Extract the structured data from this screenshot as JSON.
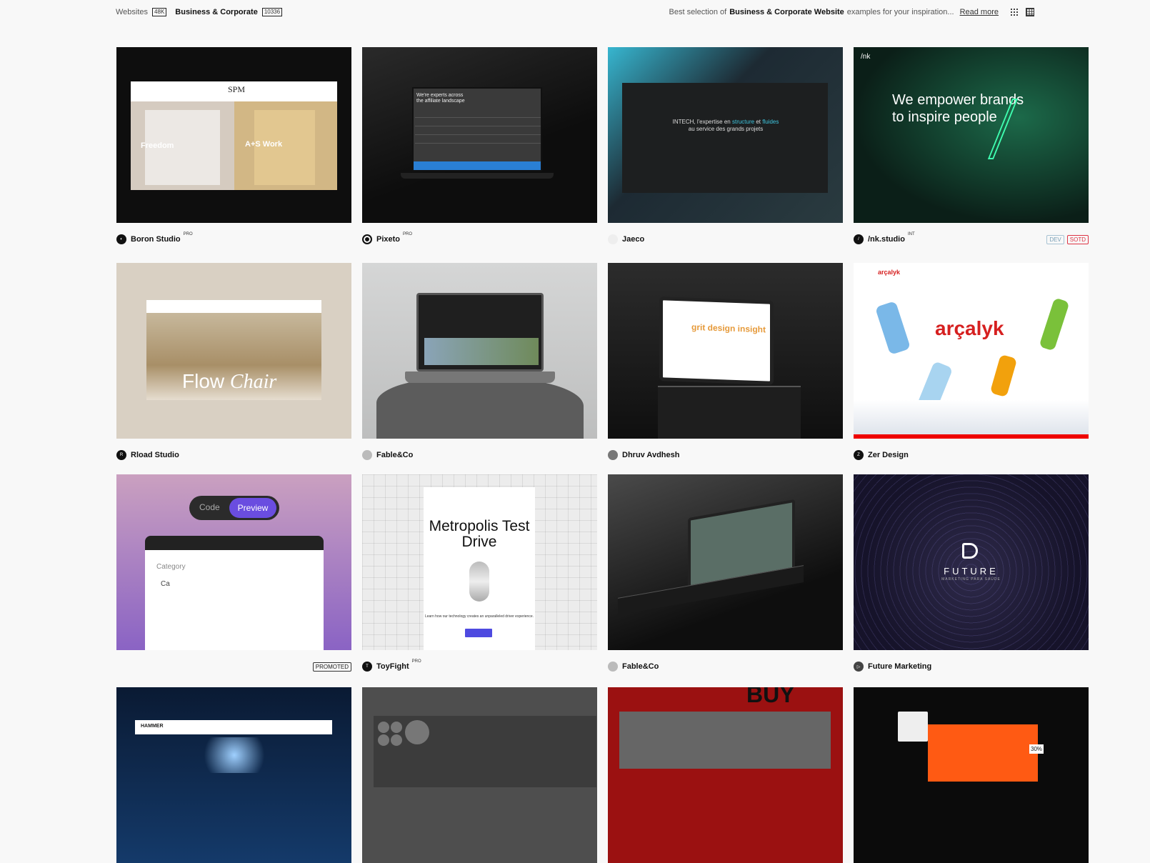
{
  "breadcrumb": {
    "websites": "Websites",
    "websites_count": "48K",
    "category": "Business & Corporate",
    "category_count": "10336"
  },
  "description": {
    "prefix": "Best selection of",
    "strong": "Business & Corporate Website",
    "suffix": "examples for your inspiration...",
    "read_more": "Read more"
  },
  "view_toggle": [
    "small-grid-icon",
    "large-grid-icon"
  ],
  "cards": [
    {
      "author": "Boron Studio",
      "tier": "PRO",
      "thumb": {
        "logo": "SPM",
        "left": "Freedom",
        "right": "A+S Work"
      }
    },
    {
      "author": "Pixeto",
      "tier": "PRO",
      "thumb": {
        "headline": "We're experts across the affiliate landscape"
      }
    },
    {
      "author": "Jaeco",
      "tier": "",
      "thumb": {
        "line1": "INTECH, l'expertise en",
        "hl1": "structure",
        "line2": "et",
        "hl2": "fluides",
        "line3": "au service des grands projets"
      }
    },
    {
      "author": "/nk.studio",
      "tier": "INT",
      "tags": [
        "DEV",
        "SOTD"
      ],
      "thumb": {
        "brand": "/nk",
        "headline": "We empower brands to inspire people"
      }
    },
    {
      "author": "Rload Studio",
      "tier": "",
      "thumb": {
        "title_a": "Flow",
        "title_b": "Chair"
      }
    },
    {
      "author": "Fable&Co",
      "tier": "",
      "thumb": {}
    },
    {
      "author": "Dhruv Avdhesh",
      "tier": "",
      "thumb": {
        "word": "grit design insight"
      }
    },
    {
      "author": "Zer Design",
      "tier": "",
      "thumb": {
        "logo": "arçalyk",
        "brand": "arçalyk"
      }
    },
    {
      "author": "",
      "tier": "",
      "tags": [
        "PROMOTED"
      ],
      "thumb": {
        "code": "Code",
        "preview": "Preview",
        "category": "Category",
        "field": "Ca"
      }
    },
    {
      "author": "ToyFight",
      "tier": "PRO",
      "thumb": {
        "headline": "Metropolis Test Drive",
        "sub": "Learn how our technology creates an unparalleled driver experience."
      }
    },
    {
      "author": "Fable&Co",
      "tier": "",
      "thumb": {}
    },
    {
      "author": "Future Marketing",
      "tier": "",
      "thumb": {
        "word": "FUTURE",
        "sub": "MARKETING PARA SAÚDE"
      }
    },
    {
      "author": "",
      "tier": "",
      "thumb": {
        "brand": "HAMMER"
      }
    },
    {
      "author": "",
      "tier": "",
      "thumb": {}
    },
    {
      "author": "",
      "tier": "",
      "thumb": {
        "word": "BUY"
      }
    },
    {
      "author": "",
      "tier": "",
      "thumb": {
        "pct": "30%"
      }
    }
  ],
  "colors": {
    "accent": "#6a4de0",
    "sotd": "#dd3344",
    "dev": "#7aa0b8"
  }
}
